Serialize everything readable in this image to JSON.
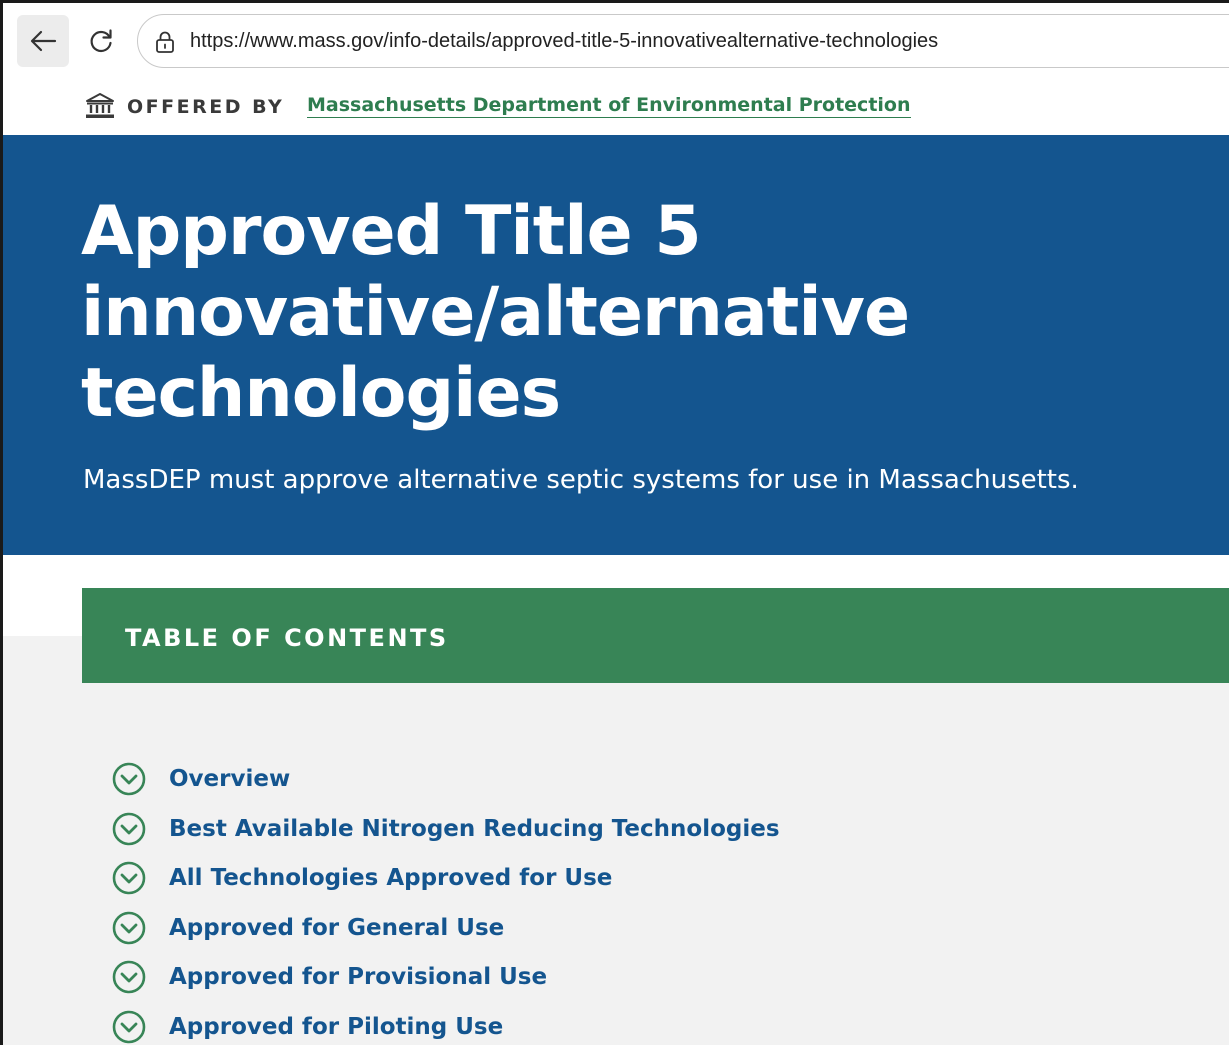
{
  "browser": {
    "url": "https://www.mass.gov/info-details/approved-title-5-innovativealternative-technologies",
    "icons": {
      "back": "arrow-left-icon",
      "reload": "reload-icon",
      "lock": "lock-icon"
    }
  },
  "offered_by": {
    "label": "OFFERED BY",
    "organization": "Massachusetts Department of Environmental Protection",
    "icon": "government-building-icon"
  },
  "hero": {
    "title_lines": [
      "Approved Title 5",
      "innovative/alternative",
      "technologies"
    ],
    "subtitle": "MassDEP must approve alternative septic systems for use in Massachusetts."
  },
  "toc": {
    "title": "TABLE OF CONTENTS",
    "items": [
      {
        "label": "Overview"
      },
      {
        "label": "Best Available Nitrogen Reducing Technologies"
      },
      {
        "label": "All Technologies Approved for Use"
      },
      {
        "label": "Approved for General Use"
      },
      {
        "label": "Approved for Provisional Use"
      },
      {
        "label": "Approved for Piloting Use"
      }
    ],
    "item_icon": "chevron-down-circle-icon"
  },
  "colors": {
    "hero_blue": "#14558f",
    "toc_green": "#388557",
    "link_green": "#2e7d4f",
    "link_blue": "#14558f",
    "page_gray": "#f2f2f2"
  }
}
